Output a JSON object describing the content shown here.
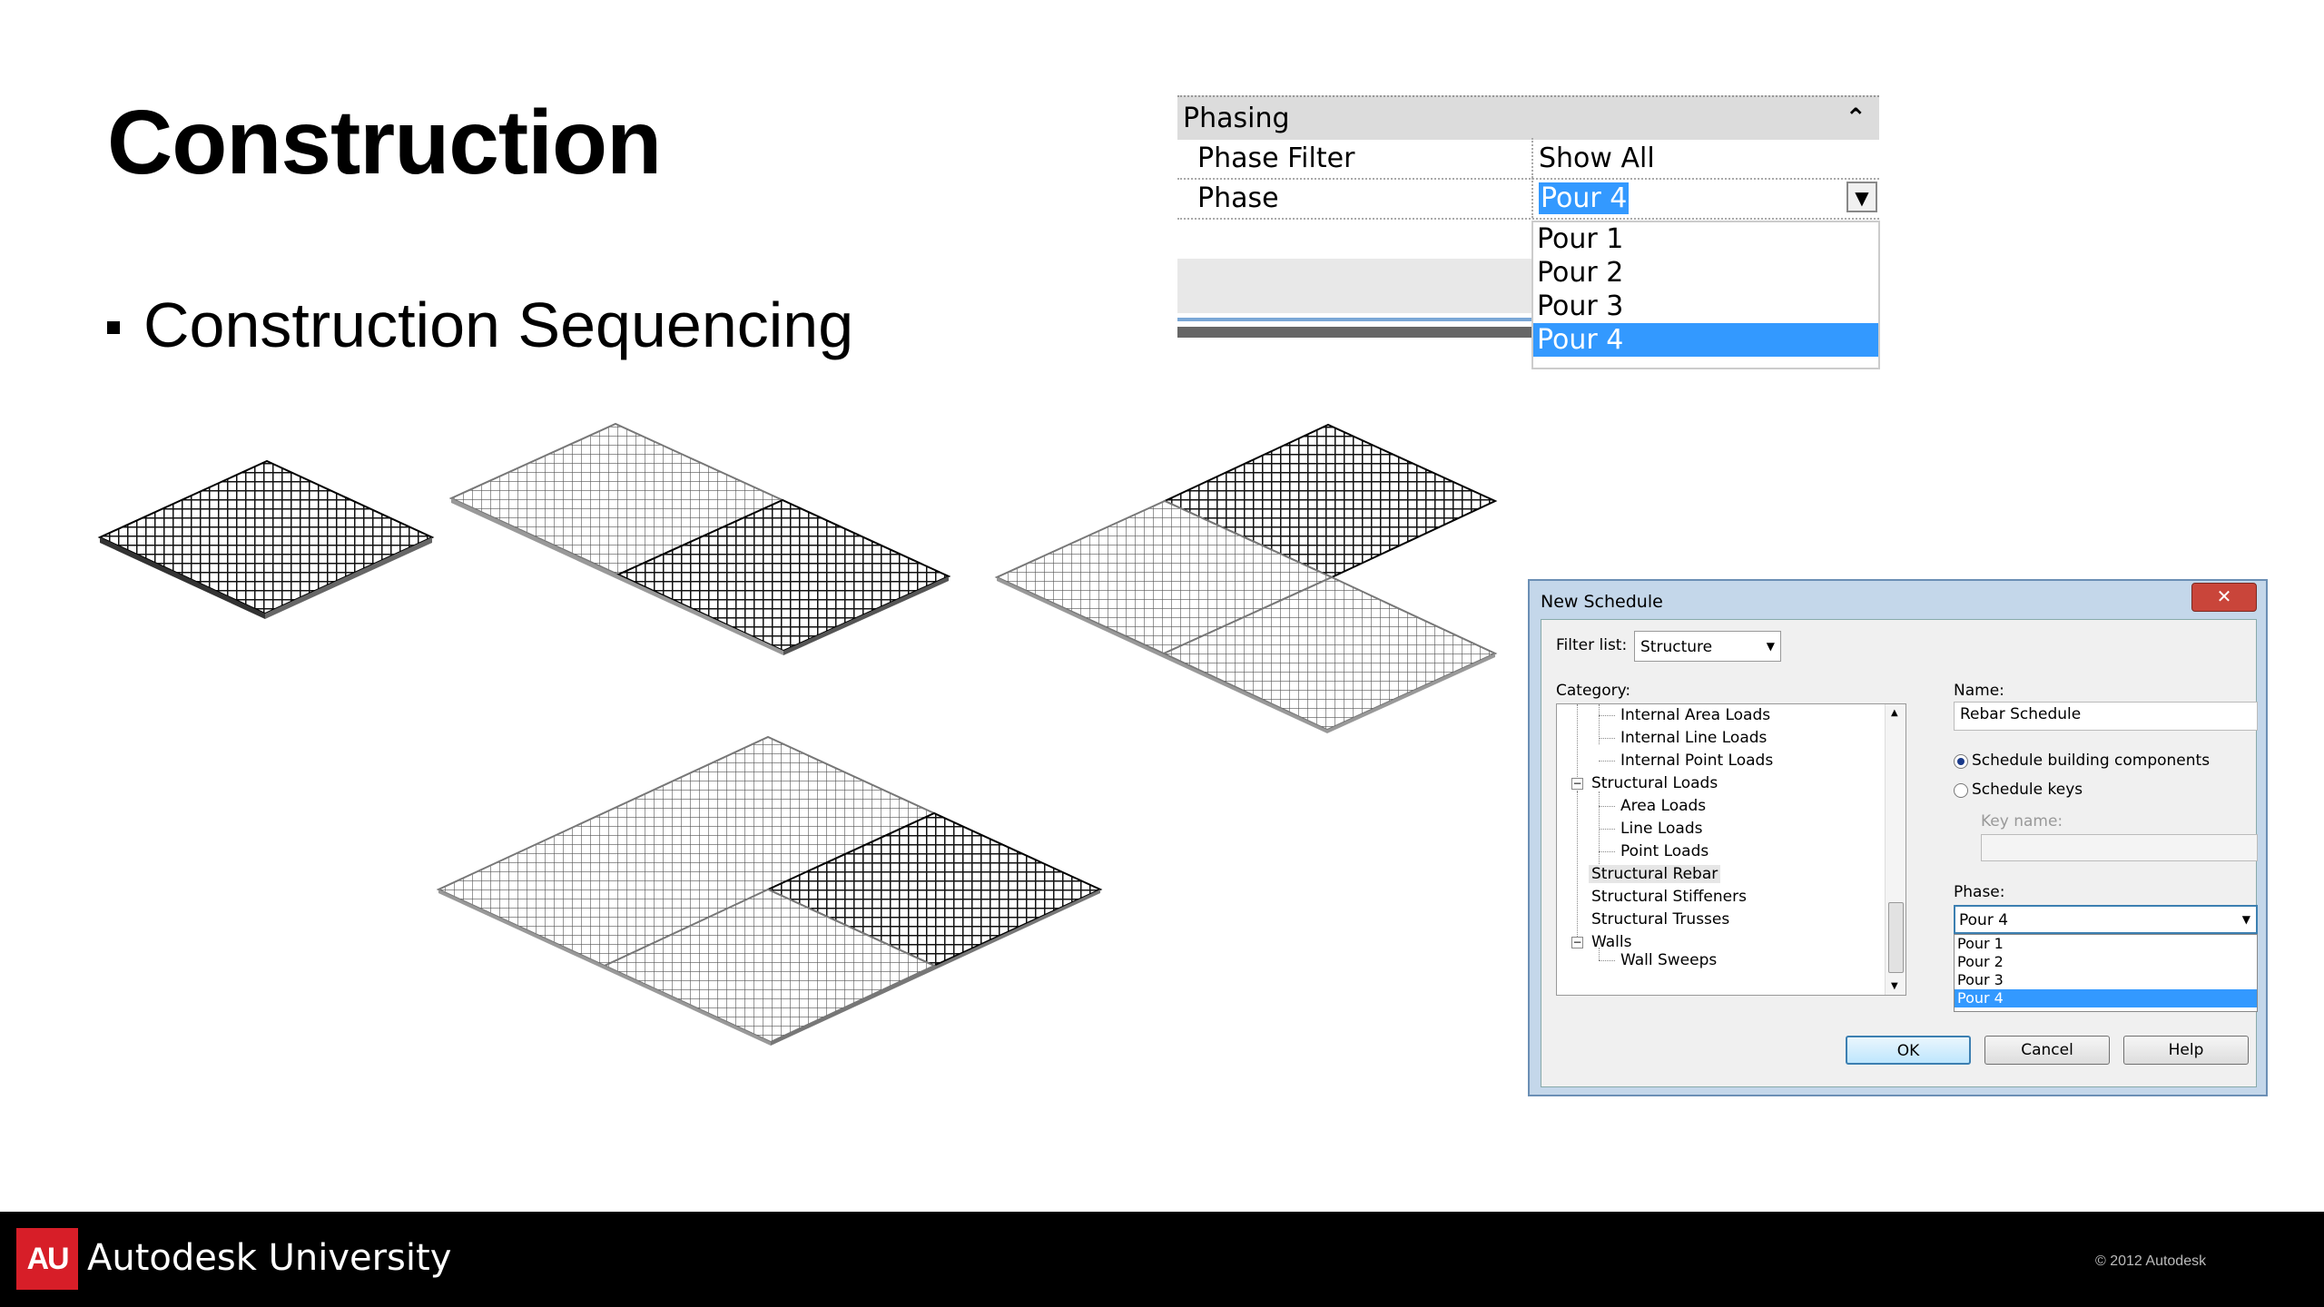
{
  "slide": {
    "title": "Construction",
    "bullet": "Construction Sequencing"
  },
  "phasing_panel": {
    "header": "Phasing",
    "rows": [
      {
        "label": "Phase Filter",
        "value": "Show All"
      },
      {
        "label": "Phase",
        "value": "Pour 4"
      }
    ],
    "options": [
      "Pour 1",
      "Pour 2",
      "Pour 3",
      "Pour 4"
    ],
    "selected_option": "Pour 4"
  },
  "dialog": {
    "title": "New Schedule",
    "close_label": "✕",
    "filter_label": "Filter list:",
    "filter_value": "Structure",
    "category_label": "Category:",
    "categories": [
      "Internal Area Loads",
      "Internal Line Loads",
      "Internal Point Loads",
      "Structural Loads",
      "Area Loads",
      "Line Loads",
      "Point Loads",
      "Structural Rebar",
      "Structural Stiffeners",
      "Structural Trusses",
      "Walls",
      "Wall Sweeps"
    ],
    "selected_category": "Structural Rebar",
    "name_label": "Name:",
    "name_value": "Rebar Schedule",
    "radio_components": "Schedule building components",
    "radio_keys": "Schedule keys",
    "key_name_label": "Key name:",
    "key_name_value": "",
    "phase_label": "Phase:",
    "phase_value": "Pour 4",
    "phase_options": [
      "Pour 1",
      "Pour 2",
      "Pour 3",
      "Pour 4"
    ],
    "ok": "OK",
    "cancel": "Cancel",
    "help": "Help"
  },
  "footer": {
    "logo": "AU",
    "brand": "Autodesk University",
    "copyright": "© 2012 Autodesk"
  },
  "colors": {
    "selection": "#3399ff",
    "brand_red": "#d71e28",
    "footer_bg": "#000000"
  }
}
